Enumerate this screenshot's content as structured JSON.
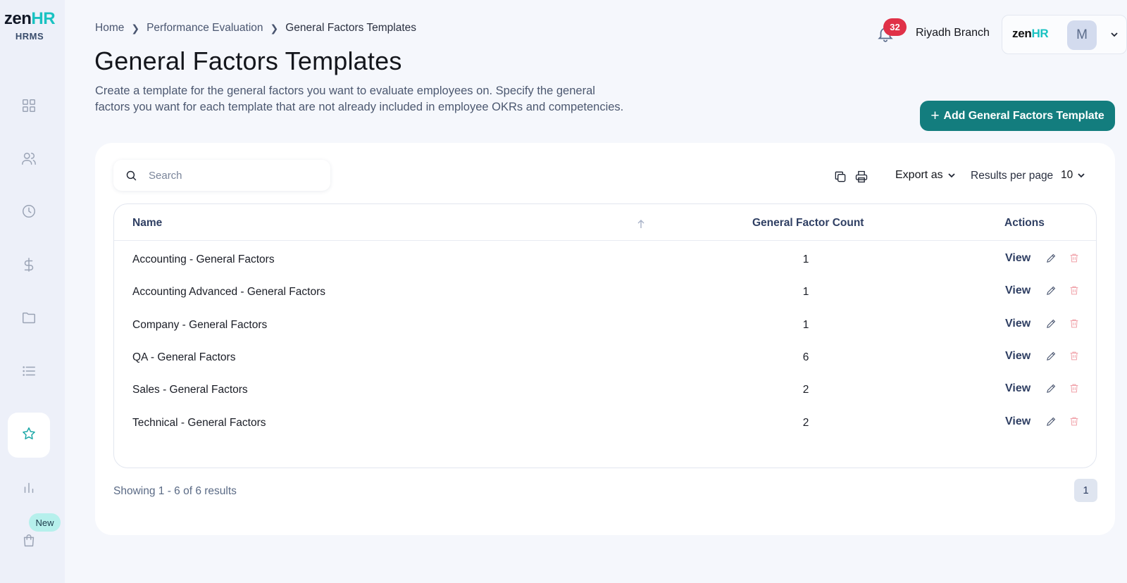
{
  "brand": {
    "logo_main": "zen",
    "logo_accent": "HR",
    "subtitle": "HRMS"
  },
  "sidebar": {
    "items": [
      {
        "icon": "dashboard-icon"
      },
      {
        "icon": "people-icon"
      },
      {
        "icon": "clock-icon"
      },
      {
        "icon": "dollar-icon"
      },
      {
        "icon": "folder-icon"
      },
      {
        "icon": "list-icon"
      },
      {
        "icon": "star-icon",
        "active": true
      },
      {
        "icon": "bar-chart-icon"
      },
      {
        "icon": "shopping-bag-icon"
      }
    ],
    "new_badge": "New"
  },
  "breadcrumb": {
    "home": "Home",
    "section": "Performance Evaluation",
    "current": "General Factors Templates"
  },
  "page": {
    "title": "General Factors Templates",
    "description": "Create a template for the general factors you want to evaluate employees on. Specify the general factors you want for each template that are not already included in employee OKRs and competencies."
  },
  "header": {
    "notification_count": "32",
    "branch": "Riyadh Branch",
    "company_logo_main": "zen",
    "company_logo_accent": "HR",
    "avatar_initial": "M"
  },
  "actions": {
    "add_button": "Add General Factors Template",
    "add_button_plus": "+"
  },
  "toolbar": {
    "search_placeholder": "Search",
    "export_label": "Export as",
    "results_per_page_label": "Results per page",
    "results_per_page_value": "10"
  },
  "table": {
    "headers": {
      "name": "Name",
      "count": "General Factor Count",
      "actions": "Actions"
    },
    "rows": [
      {
        "name": "Accounting - General Factors",
        "count": "1",
        "view": "View"
      },
      {
        "name": "Accounting Advanced - General Factors",
        "count": "1",
        "view": "View"
      },
      {
        "name": "Company - General Factors",
        "count": "1",
        "view": "View"
      },
      {
        "name": "QA - General Factors",
        "count": "6",
        "view": "View"
      },
      {
        "name": "Sales - General Factors",
        "count": "2",
        "view": "View"
      },
      {
        "name": "Technical - General Factors",
        "count": "2",
        "view": "View"
      }
    ]
  },
  "footer": {
    "showing": "Showing 1 - 6 of 6 results",
    "current_page": "1"
  },
  "colors": {
    "accent": "#137d7e",
    "brand_teal": "#19c2c2",
    "notification": "#e03148",
    "delete_icon": "#f0a0a8"
  }
}
